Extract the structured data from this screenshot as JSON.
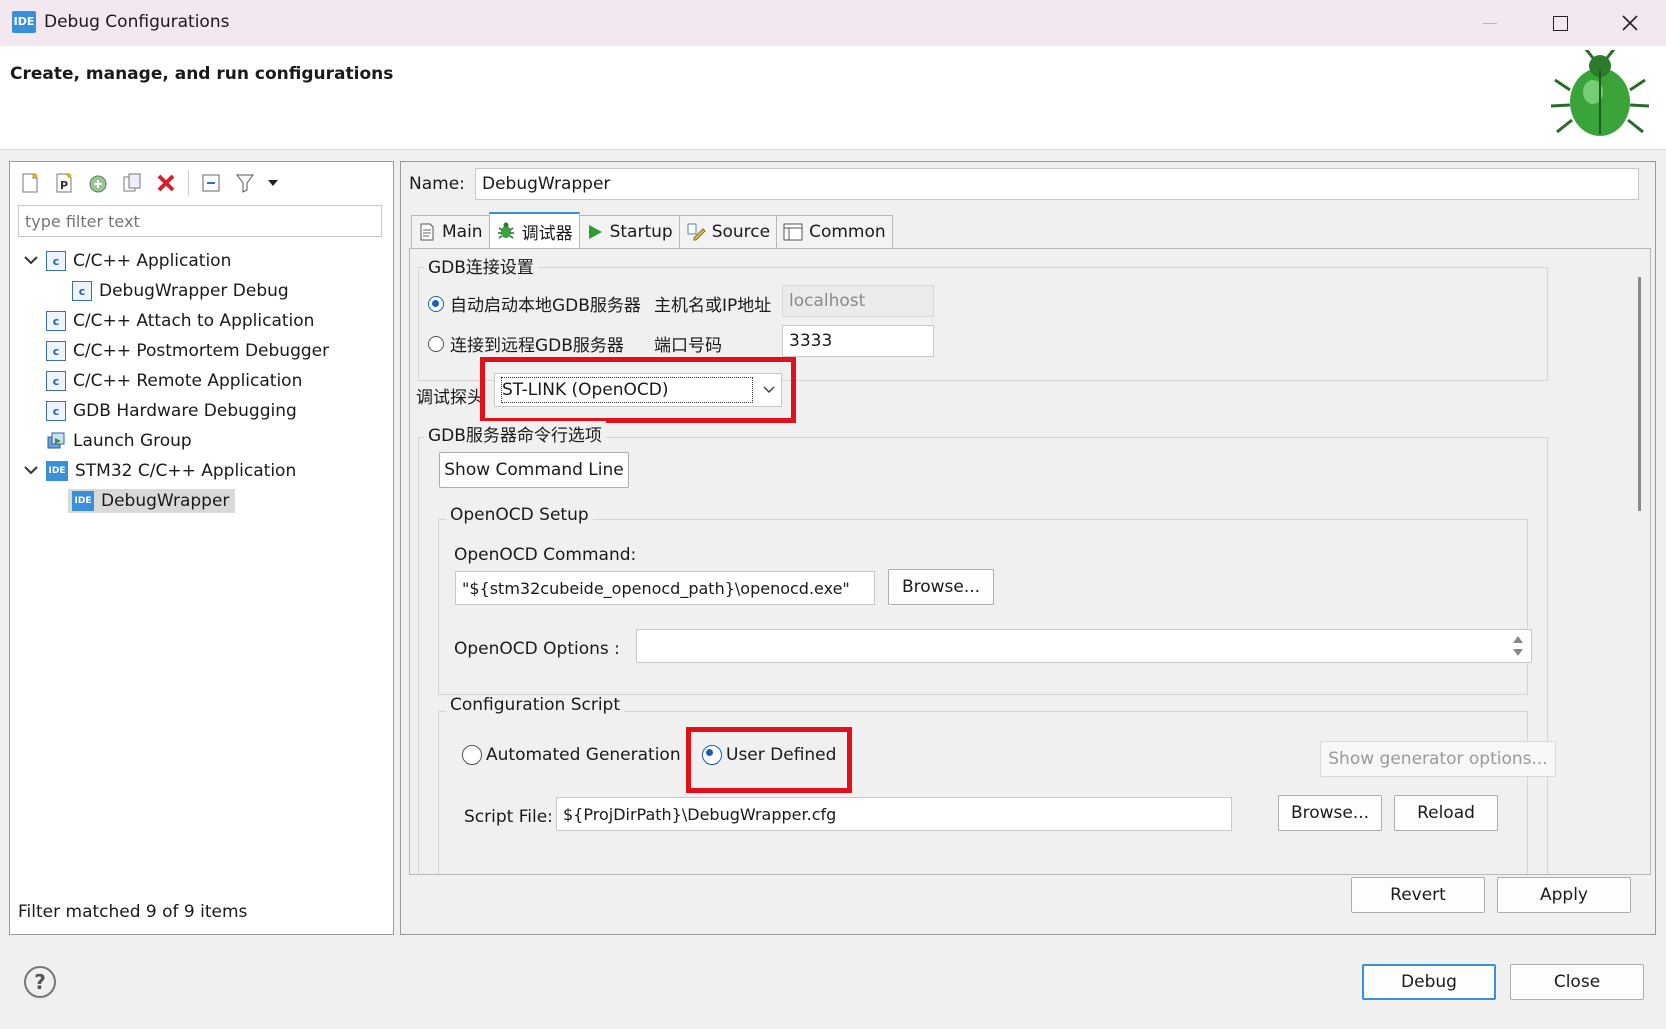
{
  "window": {
    "title": "Debug Configurations",
    "app_badge": "IDE",
    "minimize_icon": "minimize-icon",
    "maximize_icon": "maximize-icon",
    "close_icon": "close-icon"
  },
  "header": {
    "subtitle": "Create, manage, and run configurations",
    "banner_icon": "bug-icon"
  },
  "left": {
    "toolbar_icons": [
      "new-config-icon",
      "new-prototype-icon",
      "export-icon",
      "duplicate-icon",
      "delete-icon",
      "collapse-all-icon",
      "filter-icon",
      "dropdown-icon"
    ],
    "filter_placeholder": "type filter text",
    "tree": [
      {
        "label": "C/C++ Application",
        "icon": "c-icon",
        "expanded": true
      },
      {
        "label": "DebugWrapper Debug",
        "icon": "c-icon",
        "child": true
      },
      {
        "label": "C/C++ Attach to Application",
        "icon": "c-icon"
      },
      {
        "label": "C/C++ Postmortem Debugger",
        "icon": "c-icon"
      },
      {
        "label": "C/C++ Remote Application",
        "icon": "c-icon"
      },
      {
        "label": "GDB Hardware Debugging",
        "icon": "c-icon"
      },
      {
        "label": "Launch Group",
        "icon": "launch-group-icon"
      },
      {
        "label": "STM32 C/C++ Application",
        "icon": "ide-icon",
        "expanded": true
      },
      {
        "label": "DebugWrapper",
        "icon": "ide-icon",
        "child": true,
        "selected": true
      }
    ],
    "ide_badge": "IDE",
    "c_badge": "c",
    "status": "Filter matched 9 of 9 items"
  },
  "right": {
    "name_label": "Name:",
    "name_value": "DebugWrapper",
    "tabs": [
      {
        "label": "Main",
        "icon": "main-tab-icon"
      },
      {
        "label": "调试器",
        "icon": "debugger-tab-icon",
        "active": true
      },
      {
        "label": "Startup",
        "icon": "startup-tab-icon"
      },
      {
        "label": "Source",
        "icon": "source-tab-icon"
      },
      {
        "label": "Common",
        "icon": "common-tab-icon"
      }
    ],
    "gdb_group": "GDB连接设置",
    "radio_local": "自动启动本地GDB服务器",
    "radio_remote": "连接到远程GDB服务器",
    "host_label": "主机名或IP地址",
    "host_value": "localhost",
    "port_label": "端口号码",
    "port_value": "3333",
    "probe_label": "调试探头",
    "probe_value": "ST-LINK (OpenOCD)",
    "server_options_group": "GDB服务器命令行选项",
    "show_command_line": "Show Command Line",
    "openocd_setup": "OpenOCD Setup",
    "openocd_command_label": "OpenOCD Command:",
    "openocd_command_value": "\"${stm32cubeide_openocd_path}\\openocd.exe\"",
    "browse": "Browse...",
    "openocd_options_label": "OpenOCD Options :",
    "config_script": "Configuration Script",
    "radio_auto": "Automated Generation",
    "radio_user": "User Defined",
    "show_generator": "Show generator options...",
    "script_file_label": "Script File:",
    "script_file_value": "${ProjDirPath}\\DebugWrapper.cfg",
    "browse2": "Browse...",
    "reload": "Reload",
    "revert": "Revert",
    "apply": "Apply"
  },
  "footer": {
    "help_icon": "help-icon",
    "help_glyph": "?",
    "debug": "Debug",
    "close": "Close"
  }
}
